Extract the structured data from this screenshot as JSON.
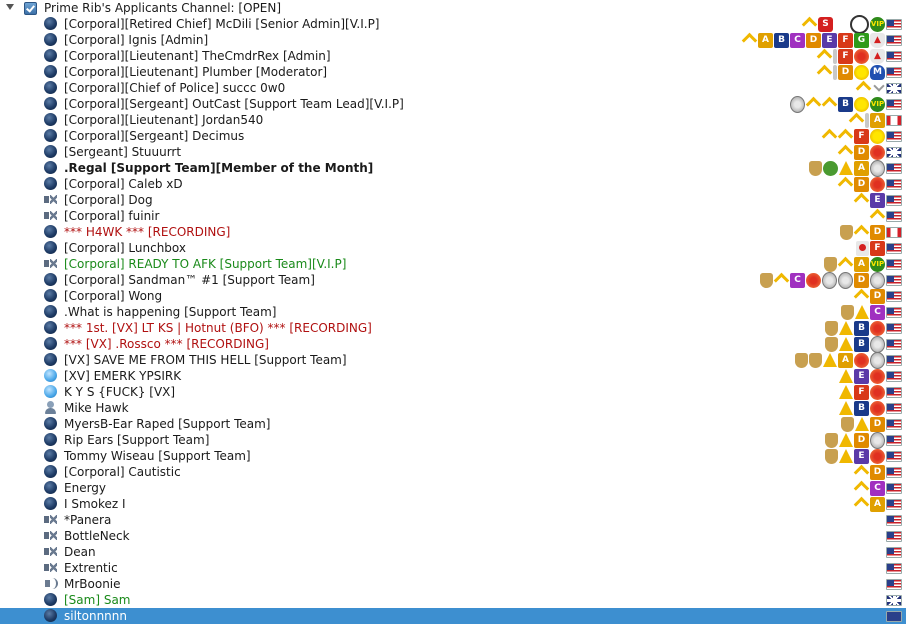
{
  "channel": {
    "name": "Prime Rib's Applicants Channel: [OPEN]"
  },
  "users": [
    {
      "name": "[Corporal][Retired Chief] McDili [Senior Admin][V.I.P]",
      "status": "idle",
      "style": "",
      "badges": [
        "flag-us",
        "vip",
        "ico-clock",
        "t-bl",
        "ico-s",
        "chev"
      ]
    },
    {
      "name": "[Corporal] Ignis [Admin]",
      "status": "idle",
      "style": "",
      "badges": [
        "flag-us",
        "ico-shield-red",
        "L-G",
        "L-F",
        "L-E",
        "L-D",
        "L-C",
        "L-B",
        "L-A",
        "chev"
      ]
    },
    {
      "name": "[Corporal][Lieutenant] TheCmdrRex [Admin]",
      "status": "idle",
      "style": "",
      "badges": [
        "flag-us",
        "ico-shield-red",
        "cross",
        "L-F",
        "bar",
        "chev"
      ]
    },
    {
      "name": "[Corporal][Lieutenant] Plumber [Moderator]",
      "status": "idle",
      "style": "",
      "badges": [
        "flag-us",
        "ico-m",
        "star",
        "L-D",
        "bar",
        "chev"
      ]
    },
    {
      "name": "[Corporal][Chief of Police] succc 0w0",
      "status": "idle",
      "style": "",
      "badges": [
        "flag-gb",
        "arrows",
        "chev"
      ]
    },
    {
      "name": "[Corporal][Sergeant] OutCast [Support Team Lead][V.I.P]",
      "status": "idle",
      "style": "",
      "badges": [
        "flag-us",
        "vip",
        "star",
        "L-B",
        "chev",
        "chev",
        "medal"
      ]
    },
    {
      "name": "[Corporal][Lieutenant] Jordan540",
      "status": "idle",
      "style": "",
      "badges": [
        "flag-ca",
        "L-A",
        "bar",
        "chev"
      ]
    },
    {
      "name": "[Corporal][Sergeant] Decimus",
      "status": "idle",
      "style": "",
      "badges": [
        "flag-us",
        "star",
        "L-F",
        "chev",
        "chev"
      ]
    },
    {
      "name": "[Sergeant] Stuuurrt",
      "status": "idle",
      "style": "",
      "badges": [
        "flag-gb",
        "cross",
        "L-D",
        "chev"
      ]
    },
    {
      "name": ".Regal [Support Team][Member of the Month]",
      "status": "idle",
      "style": "bold",
      "badges": [
        "flag-us",
        "medal",
        "L-A",
        "triangle",
        "ico-bug",
        "shield"
      ]
    },
    {
      "name": "[Corporal] Caleb xD",
      "status": "idle",
      "style": "",
      "badges": [
        "flag-us",
        "cross",
        "L-D",
        "chev"
      ]
    },
    {
      "name": "[Corporal] Dog",
      "status": "mute",
      "style": "",
      "badges": [
        "flag-us",
        "L-E",
        "chev"
      ]
    },
    {
      "name": "[Corporal] fuinir",
      "status": "mute",
      "style": "",
      "badges": [
        "flag-us",
        "chev"
      ]
    },
    {
      "name": "*** H4WK *** [RECORDING]",
      "status": "idle",
      "style": "red",
      "badges": [
        "flag-ca",
        "L-D",
        "chev",
        "shield"
      ]
    },
    {
      "name": "[Corporal] Lunchbox",
      "status": "idle",
      "style": "",
      "badges": [
        "flag-us",
        "L-F",
        "reddot"
      ]
    },
    {
      "name": "[Corporal] READY TO AFK [Support Team][V.I.P]",
      "status": "mute",
      "style": "green",
      "badges": [
        "flag-us",
        "vip",
        "L-A",
        "chev",
        "shield"
      ]
    },
    {
      "name": "[Corporal] Sandman™ #1 [Support Team]",
      "status": "idle",
      "style": "",
      "badges": [
        "flag-us",
        "medal",
        "L-D",
        "medal",
        "medal",
        "cross",
        "L-C",
        "chev",
        "shield"
      ]
    },
    {
      "name": "[Corporal] Wong",
      "status": "idle",
      "style": "",
      "badges": [
        "flag-us",
        "L-D",
        "chev"
      ]
    },
    {
      "name": ".What is happening [Support Team]",
      "status": "idle",
      "style": "",
      "badges": [
        "flag-us",
        "L-C",
        "triangle",
        "shield"
      ]
    },
    {
      "name": "*** 1st. [VX] LT KS | Hotnut (BFO) *** [RECORDING]",
      "status": "idle",
      "style": "red",
      "badges": [
        "flag-us",
        "cross",
        "L-B",
        "triangle",
        "shield"
      ]
    },
    {
      "name": "*** [VX] .Rossco *** [RECORDING]",
      "status": "idle",
      "style": "red",
      "badges": [
        "flag-us",
        "medal",
        "L-B",
        "triangle",
        "shield"
      ]
    },
    {
      "name": "[VX] SAVE ME FROM THIS HELL [Support Team]",
      "status": "idle",
      "style": "",
      "badges": [
        "flag-us",
        "medal",
        "cross",
        "L-A",
        "triangle",
        "shield",
        "shield"
      ]
    },
    {
      "name": "[XV] EMERK YPSIRK",
      "status": "away",
      "style": "",
      "badges": [
        "flag-us",
        "cross",
        "L-E",
        "triangle"
      ]
    },
    {
      "name": "K Y S {FUCK} [VX]",
      "status": "away",
      "style": "",
      "badges": [
        "flag-us",
        "cross",
        "L-F",
        "triangle"
      ]
    },
    {
      "name": "Mike Hawk",
      "status": "person",
      "style": "",
      "badges": [
        "flag-us",
        "cross",
        "L-B",
        "triangle"
      ]
    },
    {
      "name": "MyersB-Ear Raped [Support Team]",
      "status": "idle",
      "style": "",
      "badges": [
        "flag-us",
        "L-D",
        "triangle",
        "shield"
      ]
    },
    {
      "name": "Rip Ears [Support Team]",
      "status": "idle",
      "style": "",
      "badges": [
        "flag-us",
        "medal",
        "L-D",
        "triangle",
        "shield"
      ]
    },
    {
      "name": "Tommy Wiseau [Support Team]",
      "status": "idle",
      "style": "",
      "badges": [
        "flag-us",
        "cross",
        "L-E",
        "triangle",
        "shield"
      ]
    },
    {
      "name": "[Corporal] Cautistic",
      "status": "idle",
      "style": "",
      "badges": [
        "flag-us",
        "L-D",
        "chev"
      ]
    },
    {
      "name": "Energy",
      "status": "idle",
      "style": "",
      "badges": [
        "flag-us",
        "L-C",
        "chev"
      ]
    },
    {
      "name": "I Smokez I",
      "status": "idle",
      "style": "",
      "badges": [
        "flag-us",
        "L-A",
        "chev"
      ]
    },
    {
      "name": "*Panera",
      "status": "mute",
      "style": "",
      "badges": [
        "flag-us"
      ]
    },
    {
      "name": "BottleNeck",
      "status": "mute",
      "style": "",
      "badges": [
        "flag-us"
      ]
    },
    {
      "name": "Dean",
      "status": "mute",
      "style": "",
      "badges": [
        "flag-us"
      ]
    },
    {
      "name": "Extrentic",
      "status": "mute",
      "style": "",
      "badges": [
        "flag-us"
      ]
    },
    {
      "name": "MrBoonie",
      "status": "speaker",
      "style": "",
      "badges": [
        "flag-us"
      ]
    },
    {
      "name": "[Sam] Sam",
      "status": "idle",
      "style": "green",
      "badges": [
        "flag-gb"
      ]
    },
    {
      "name": "siltonnnnn",
      "status": "idle",
      "style": "",
      "badges": [
        "flag-au"
      ],
      "selected": true
    }
  ],
  "badge_colors": {
    "A": "#e0a000",
    "B": "#1a3a8a",
    "C": "#a030c0",
    "D": "#e08a00",
    "E": "#5a3aa8",
    "F": "#d83818",
    "G": "#2e9a1a"
  },
  "badge_letters": [
    "A",
    "B",
    "C",
    "D",
    "E",
    "F",
    "G"
  ]
}
